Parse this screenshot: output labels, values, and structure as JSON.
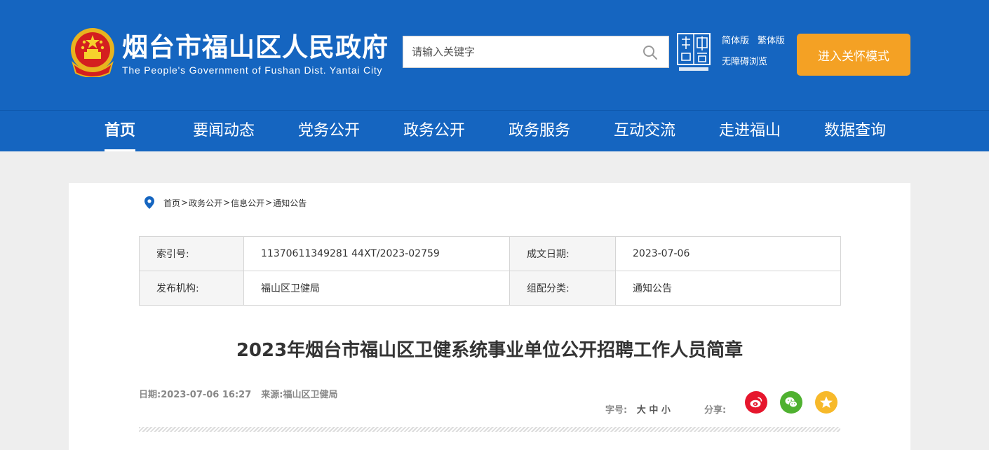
{
  "header": {
    "title": "烟台市福山区人民政府",
    "subtitle": "The People's Government of Fushan Dist. Yantai City",
    "search_placeholder": "请输入关键字",
    "lang_simplified": "简体版",
    "lang_traditional": "繁体版",
    "accessibility": "无障碍浏览",
    "care_mode": "进入关怀模式",
    "colors": {
      "brand_blue": "#1565c0",
      "care_orange": "#f4a124"
    }
  },
  "nav": {
    "items": [
      {
        "label": "首页"
      },
      {
        "label": "要闻动态"
      },
      {
        "label": "党务公开"
      },
      {
        "label": "政务公开"
      },
      {
        "label": "政务服务"
      },
      {
        "label": "互动交流"
      },
      {
        "label": "走进福山"
      },
      {
        "label": "数据查询"
      }
    ],
    "active": "首页"
  },
  "breadcrumb": [
    "首页",
    "政务公开",
    "信息公开",
    "通知公告"
  ],
  "meta": {
    "index_label": "索引号:",
    "index_value": "11370611349281 44XT/2023-02759",
    "date_label": "成文日期:",
    "date_value": "2023-07-06",
    "issuer_label": "发布机构:",
    "issuer_value": "福山区卫健局",
    "category_label": "组配分类:",
    "category_value": "通知公告"
  },
  "article": {
    "title": "2023年烟台市福山区卫健系统事业单位公开招聘工作人员简章",
    "date": "日期:2023-07-06 16:27",
    "source": "来源:福山区卫健局",
    "font_size_label": "字号:",
    "font_sizes": [
      "大",
      "中",
      "小"
    ],
    "share_label": "分享:"
  },
  "icons": {
    "emblem": "national-emblem-icon",
    "search": "search-icon",
    "china_logo": "china-yantai-logo-icon",
    "location": "map-pin-icon",
    "weibo": "weibo-icon",
    "wechat": "wechat-icon",
    "qzone": "qzone-star-icon"
  }
}
